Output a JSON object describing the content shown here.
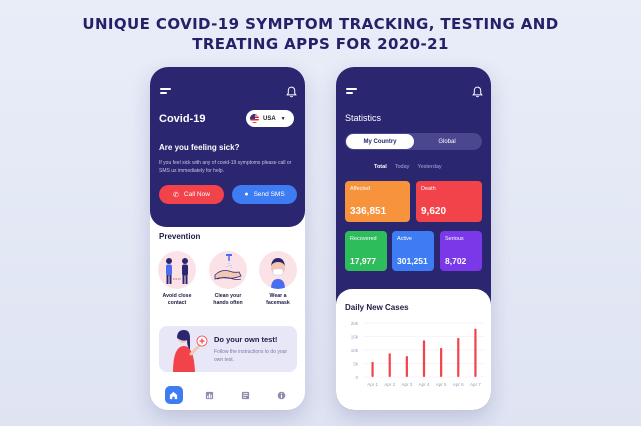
{
  "headline": {
    "line1": "UNIQUE COVID-19 SYMPTOM TRACKING, TESTING AND",
    "line2": "TREATING APPS FOR 2020-21"
  },
  "colors": {
    "navy": "#2a2770",
    "red": "#f2424a",
    "blue": "#3d7cf2",
    "orange": "#f6933c",
    "green": "#2ebd5b",
    "purple": "#7a38e8",
    "pink": "#fbe2e6"
  },
  "home": {
    "title": "Covid-19",
    "country": "USA",
    "country_icon": "us-flag-icon",
    "sick_title": "Are you feeling sick?",
    "sick_desc": "If you feel sick with any of covid-19 symptoms please call or SMS us immediately for help.",
    "call_label": "Call Now",
    "sms_label": "Send SMS",
    "prevention_title": "Prevention",
    "prevention": [
      {
        "label1": "Avoid close",
        "label2": "contact",
        "icon": "people-distance-icon"
      },
      {
        "label1": "Clean your",
        "label2": "hands often",
        "icon": "hand-washing-icon"
      },
      {
        "label1": "Wear a",
        "label2": "facemask",
        "icon": "facemask-icon"
      }
    ],
    "test_title": "Do your own test!",
    "test_desc": "Follow the instructions to do your own test.",
    "nav": [
      "home-icon",
      "chart-icon",
      "news-icon",
      "info-icon"
    ]
  },
  "stats": {
    "title": "Statistics",
    "tabs": [
      "My Country",
      "Global"
    ],
    "subtabs": [
      "Total",
      "Today",
      "Yesterday"
    ],
    "cards": [
      {
        "label": "Affected",
        "value": "336,851",
        "color": "#f6933c"
      },
      {
        "label": "Death",
        "value": "9,620",
        "color": "#f2424a"
      },
      {
        "label": "Recovered",
        "value": "17,977",
        "color": "#2ebd5b"
      },
      {
        "label": "Active",
        "value": "301,251",
        "color": "#3d7cf2"
      },
      {
        "label": "Serious",
        "value": "8,702",
        "color": "#7a38e8"
      }
    ]
  },
  "chart_data": {
    "type": "bar",
    "title": "Daily New Cases",
    "categories": [
      "Apr 1",
      "Apr 2",
      "Apr 3",
      "Apr 4",
      "Apr 5",
      "Apr 6",
      "Apr 7"
    ],
    "values": [
      5600,
      8800,
      7800,
      13600,
      10800,
      14500,
      17900
    ],
    "yticks": [
      "20k",
      "15k",
      "10k",
      "5k",
      "0"
    ],
    "ylim": [
      0,
      20000
    ],
    "bar_color": "#f2424a",
    "grid": true
  }
}
